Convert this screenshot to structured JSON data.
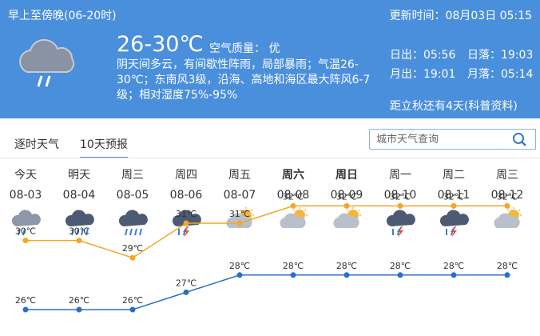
{
  "header": {
    "period": "早上至傍晚(06-20时)",
    "update": "更新时间：08月03日 05:15",
    "temp": "26-30℃",
    "aqi": "空气质量：  优",
    "description": "阴天间多云，有间歇性阵雨，局部暴雨；气温26-30℃；东南风3级，沿海、高地和海区最大阵风6-7级；相对湿度75%-95%",
    "sunrise": "日出：05:56",
    "sunset": "日落：19:03",
    "moonrise": "月出：19:01",
    "moonset": "月落：05:14",
    "countdown": "距立秋还有4天(科普资料)",
    "icon": "cloud-rain-icon"
  },
  "tabs": [
    {
      "label": "逐时天气",
      "active": false
    },
    {
      "label": "10天预报",
      "active": true
    }
  ],
  "search": {
    "placeholder": "城市天气查询",
    "icon": "search-icon"
  },
  "days": [
    {
      "name": "今天",
      "date": "08-03",
      "icon": "light-rain",
      "bold": false
    },
    {
      "name": "明天",
      "date": "08-04",
      "icon": "heavy-rain",
      "bold": false
    },
    {
      "name": "周三",
      "date": "08-05",
      "icon": "heavy-rain",
      "bold": false
    },
    {
      "name": "周四",
      "date": "08-06",
      "icon": "thunder-rain",
      "bold": false
    },
    {
      "name": "周五",
      "date": "08-07",
      "icon": "partly-cloudy",
      "bold": false
    },
    {
      "name": "周六",
      "date": "08-08",
      "icon": "partly-cloudy",
      "bold": true
    },
    {
      "name": "周日",
      "date": "08-09",
      "icon": "partly-cloudy",
      "bold": true
    },
    {
      "name": "周一",
      "date": "08-10",
      "icon": "thunder-rain",
      "bold": false
    },
    {
      "name": "周二",
      "date": "08-11",
      "icon": "thunder-rain",
      "bold": false
    },
    {
      "name": "周三",
      "date": "08-12",
      "icon": "partly-cloudy",
      "bold": false
    }
  ],
  "chart_data": {
    "type": "line",
    "x": [
      "08-03",
      "08-04",
      "08-05",
      "08-06",
      "08-07",
      "08-08",
      "08-09",
      "08-10",
      "08-11",
      "08-12"
    ],
    "series": [
      {
        "values": [
          30,
          30,
          29,
          31,
          31,
          32,
          32,
          32,
          32,
          32
        ],
        "labels": [
          "30℃",
          "30℃",
          "29℃",
          "31℃",
          "31℃",
          "32℃",
          "32℃",
          "32℃",
          "32℃",
          "32℃"
        ],
        "color": "#f5a623"
      },
      {
        "values": [
          26,
          26,
          26,
          27,
          28,
          28,
          28,
          28,
          28,
          28
        ],
        "labels": [
          "26℃",
          "26℃",
          "26℃",
          "27℃",
          "28℃",
          "28℃",
          "28℃",
          "28℃",
          "28℃",
          "28℃"
        ],
        "color": "#2a6fc9"
      }
    ],
    "grid": false
  },
  "colors": {
    "header": "#4a8fdc",
    "accent": "#4a8fdc",
    "high": "#f5a623",
    "low": "#2a6fc9"
  }
}
